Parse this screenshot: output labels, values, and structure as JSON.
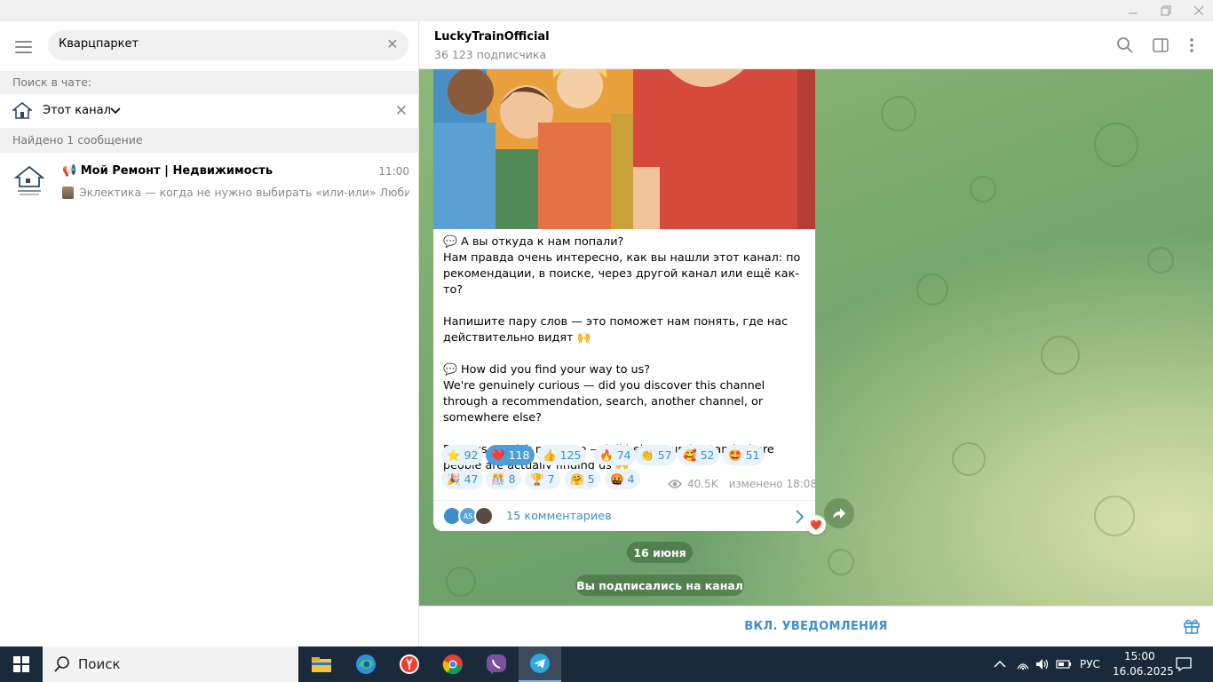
{
  "left_panel": {
    "search_value": "Кварцпаркет",
    "search_in_chat_label": "Поиск в чате:",
    "chat_filter_label": "Этот канал",
    "found_label": "Найдено 1 сообщение",
    "result": {
      "title": "Мой Ремонт | Недвижимость",
      "time": "11:00",
      "preview": "Эклектика — когда не нужно выбирать «или-или»  Любит..."
    }
  },
  "header": {
    "channel_name": "LuckyTrainOfficial",
    "subscribers": "36 123 подписчика"
  },
  "message": {
    "paragraphs": [
      "💬 А вы откуда к нам попали?\nНам правда очень интересно, как вы нашли этот канал: по рекомендации, в поиске, через другой канал или ещё как-то?",
      "Напишите пару слов — это поможет нам понять, где нас действительно видят 🙌",
      "💬 How did you find your way to us?\nWe're genuinely curious — did you discover this channel through a recommendation, search, another channel, or somewhere else?",
      "Drop us a quick message — it'll help us understand where people are actually finding us 🙌"
    ],
    "reactions": [
      {
        "emoji": "⭐",
        "count": "92"
      },
      {
        "emoji": "❤️",
        "count": "118"
      },
      {
        "emoji": "👍",
        "count": "125"
      },
      {
        "emoji": "🔥",
        "count": "74"
      },
      {
        "emoji": "👏",
        "count": "57"
      },
      {
        "emoji": "🥰",
        "count": "52"
      },
      {
        "emoji": "🤩",
        "count": "51"
      },
      {
        "emoji": "🎉",
        "count": "47"
      },
      {
        "emoji": "🎊",
        "count": "8"
      },
      {
        "emoji": "🏆",
        "count": "7"
      },
      {
        "emoji": "🤗",
        "count": "5"
      },
      {
        "emoji": "🤬",
        "count": "4"
      }
    ],
    "views": "40.5K",
    "edited": "изменено 18:08",
    "comments_label": "15 комментариев",
    "commenter_initials": "AS"
  },
  "date_pill": "16 июня",
  "subscribed_pill": "Вы подписались на канал",
  "bottom_bar": {
    "notify_label": "ВКЛ. УВЕДОМЛЕНИЯ"
  },
  "taskbar": {
    "search_label": "Поиск",
    "language": "РУС",
    "time": "15:00",
    "date": "16.06.2025"
  },
  "colors": {
    "accent": "#3a8fd0",
    "chat_bg": "#7aa96e",
    "taskbar": "#1b2a3a"
  }
}
